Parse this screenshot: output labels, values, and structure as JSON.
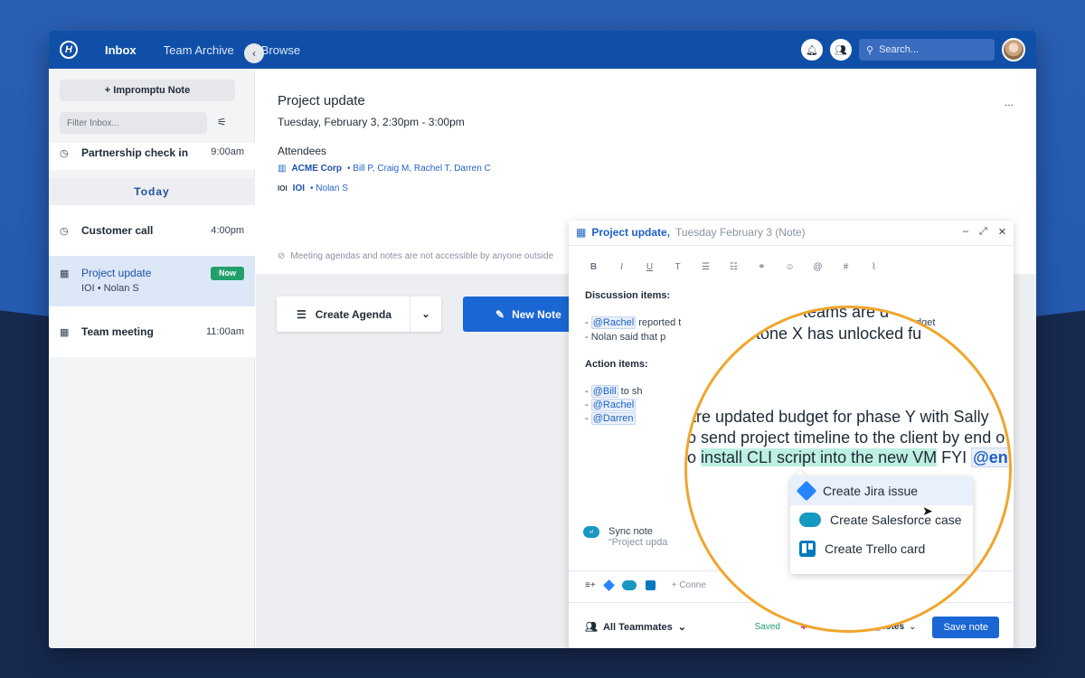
{
  "nav": {
    "logo": "H",
    "tabs": [
      "Inbox",
      "Team Archive",
      "Browse"
    ],
    "search_placeholder": "Search..."
  },
  "sidebar": {
    "impromptu_label": "+  Impromptu Note",
    "filter_placeholder": "Filter Inbox...",
    "today_label": "Today",
    "items": [
      {
        "title": "Partnership check in",
        "time": "9:00am",
        "icon": "clock-icon"
      },
      {
        "title": "Customer call",
        "time": "4:00pm",
        "icon": "clock-icon"
      },
      {
        "title": "Project update",
        "sub": "IOI  •  Nolan S",
        "badge": "Now",
        "icon": "calendar-icon"
      },
      {
        "title": "Team meeting",
        "time": "11:00am",
        "icon": "calendar-icon"
      }
    ]
  },
  "meeting": {
    "title": "Project update",
    "date": "Tuesday, February 3,  2:30pm - 3:00pm",
    "attendees_label": "Attendees",
    "org1": "ACME Corp",
    "org1_people": "•  Bill P,  Craig M,  Rachel T,  Darren C",
    "org2": "IOI",
    "org2_people": "•  Nolan S",
    "notice": "Meeting agendas and notes are not accessible by anyone outside",
    "more": "..."
  },
  "actions": {
    "create_agenda": "Create Agenda",
    "new_note": "New Note"
  },
  "note": {
    "title": "Project update,",
    "subtitle": "Tuesday February 3 (Note)",
    "toolbar": [
      "B",
      "I",
      "U",
      "T",
      "☰",
      "☷",
      "⚭",
      "☺",
      "@",
      "#",
      "⌇"
    ],
    "discussion_title": "Discussion items:",
    "discussion_lines": [
      {
        "mention": "@Rachel",
        "text": " reported t",
        "tail": "dget"
      },
      {
        "text": "- Nolan said that p"
      }
    ],
    "action_title": "Action items:",
    "action_lines": [
      {
        "mention": "@Bill",
        "text": " to sh"
      },
      {
        "mention": "@Rachel",
        "text": ""
      },
      {
        "mention": "@Darren",
        "text": ""
      }
    ],
    "sync_title": "Sync note",
    "sync_sub": "“Project upda",
    "connect": "+  Conne",
    "footer_team": "All Teammates",
    "saved": "Saved",
    "post_to": "Post to",
    "channel": "project_notes",
    "save_button": "Save note"
  },
  "magnifier": {
    "line0": "teams are d",
    "line1": "tone X has unlocked fu",
    "line2": "are updated budget for phase Y with Sally",
    "line3": "o send project timeline to the client by end o",
    "line4_pre": "o ",
    "line4_hl": "install CLI script into the new VM",
    "line4_post": " FYI ",
    "line4_mention": "@en",
    "menu": [
      "Create Jira issue",
      "Create Salesforce case",
      "Create Trello card"
    ]
  }
}
